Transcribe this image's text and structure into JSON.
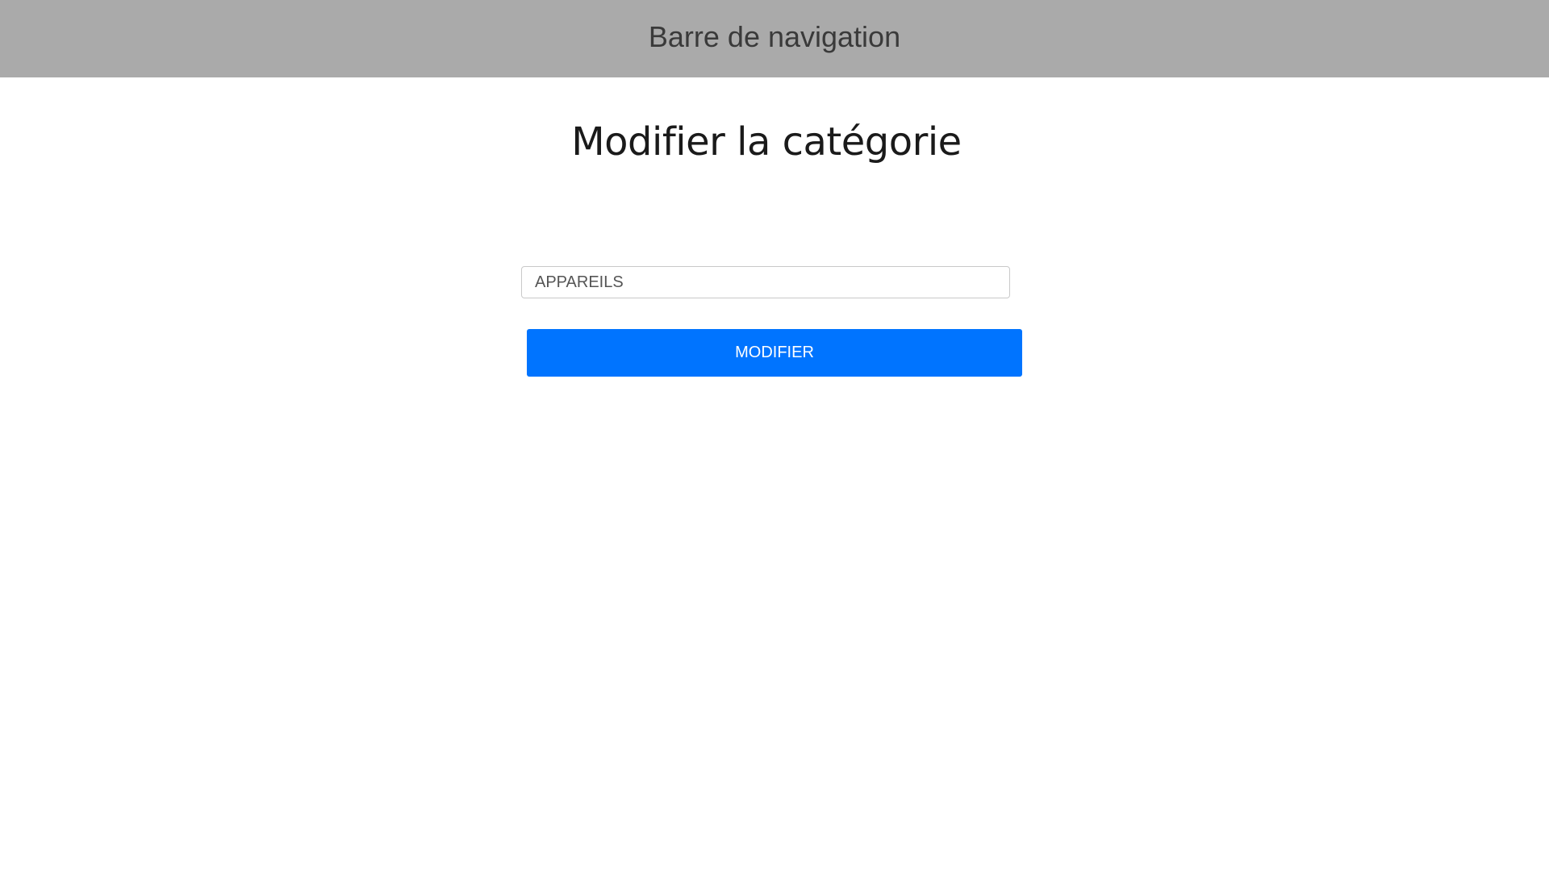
{
  "navbar": {
    "title": "Barre de navigation",
    "background": "#aaaaaa"
  },
  "main": {
    "title": "Modifier la catégorie",
    "form": {
      "category_input": {
        "value": "APPAREILS",
        "placeholder": ""
      },
      "submit_label": "MODIFIER",
      "submit_color": "#0074ff"
    }
  }
}
